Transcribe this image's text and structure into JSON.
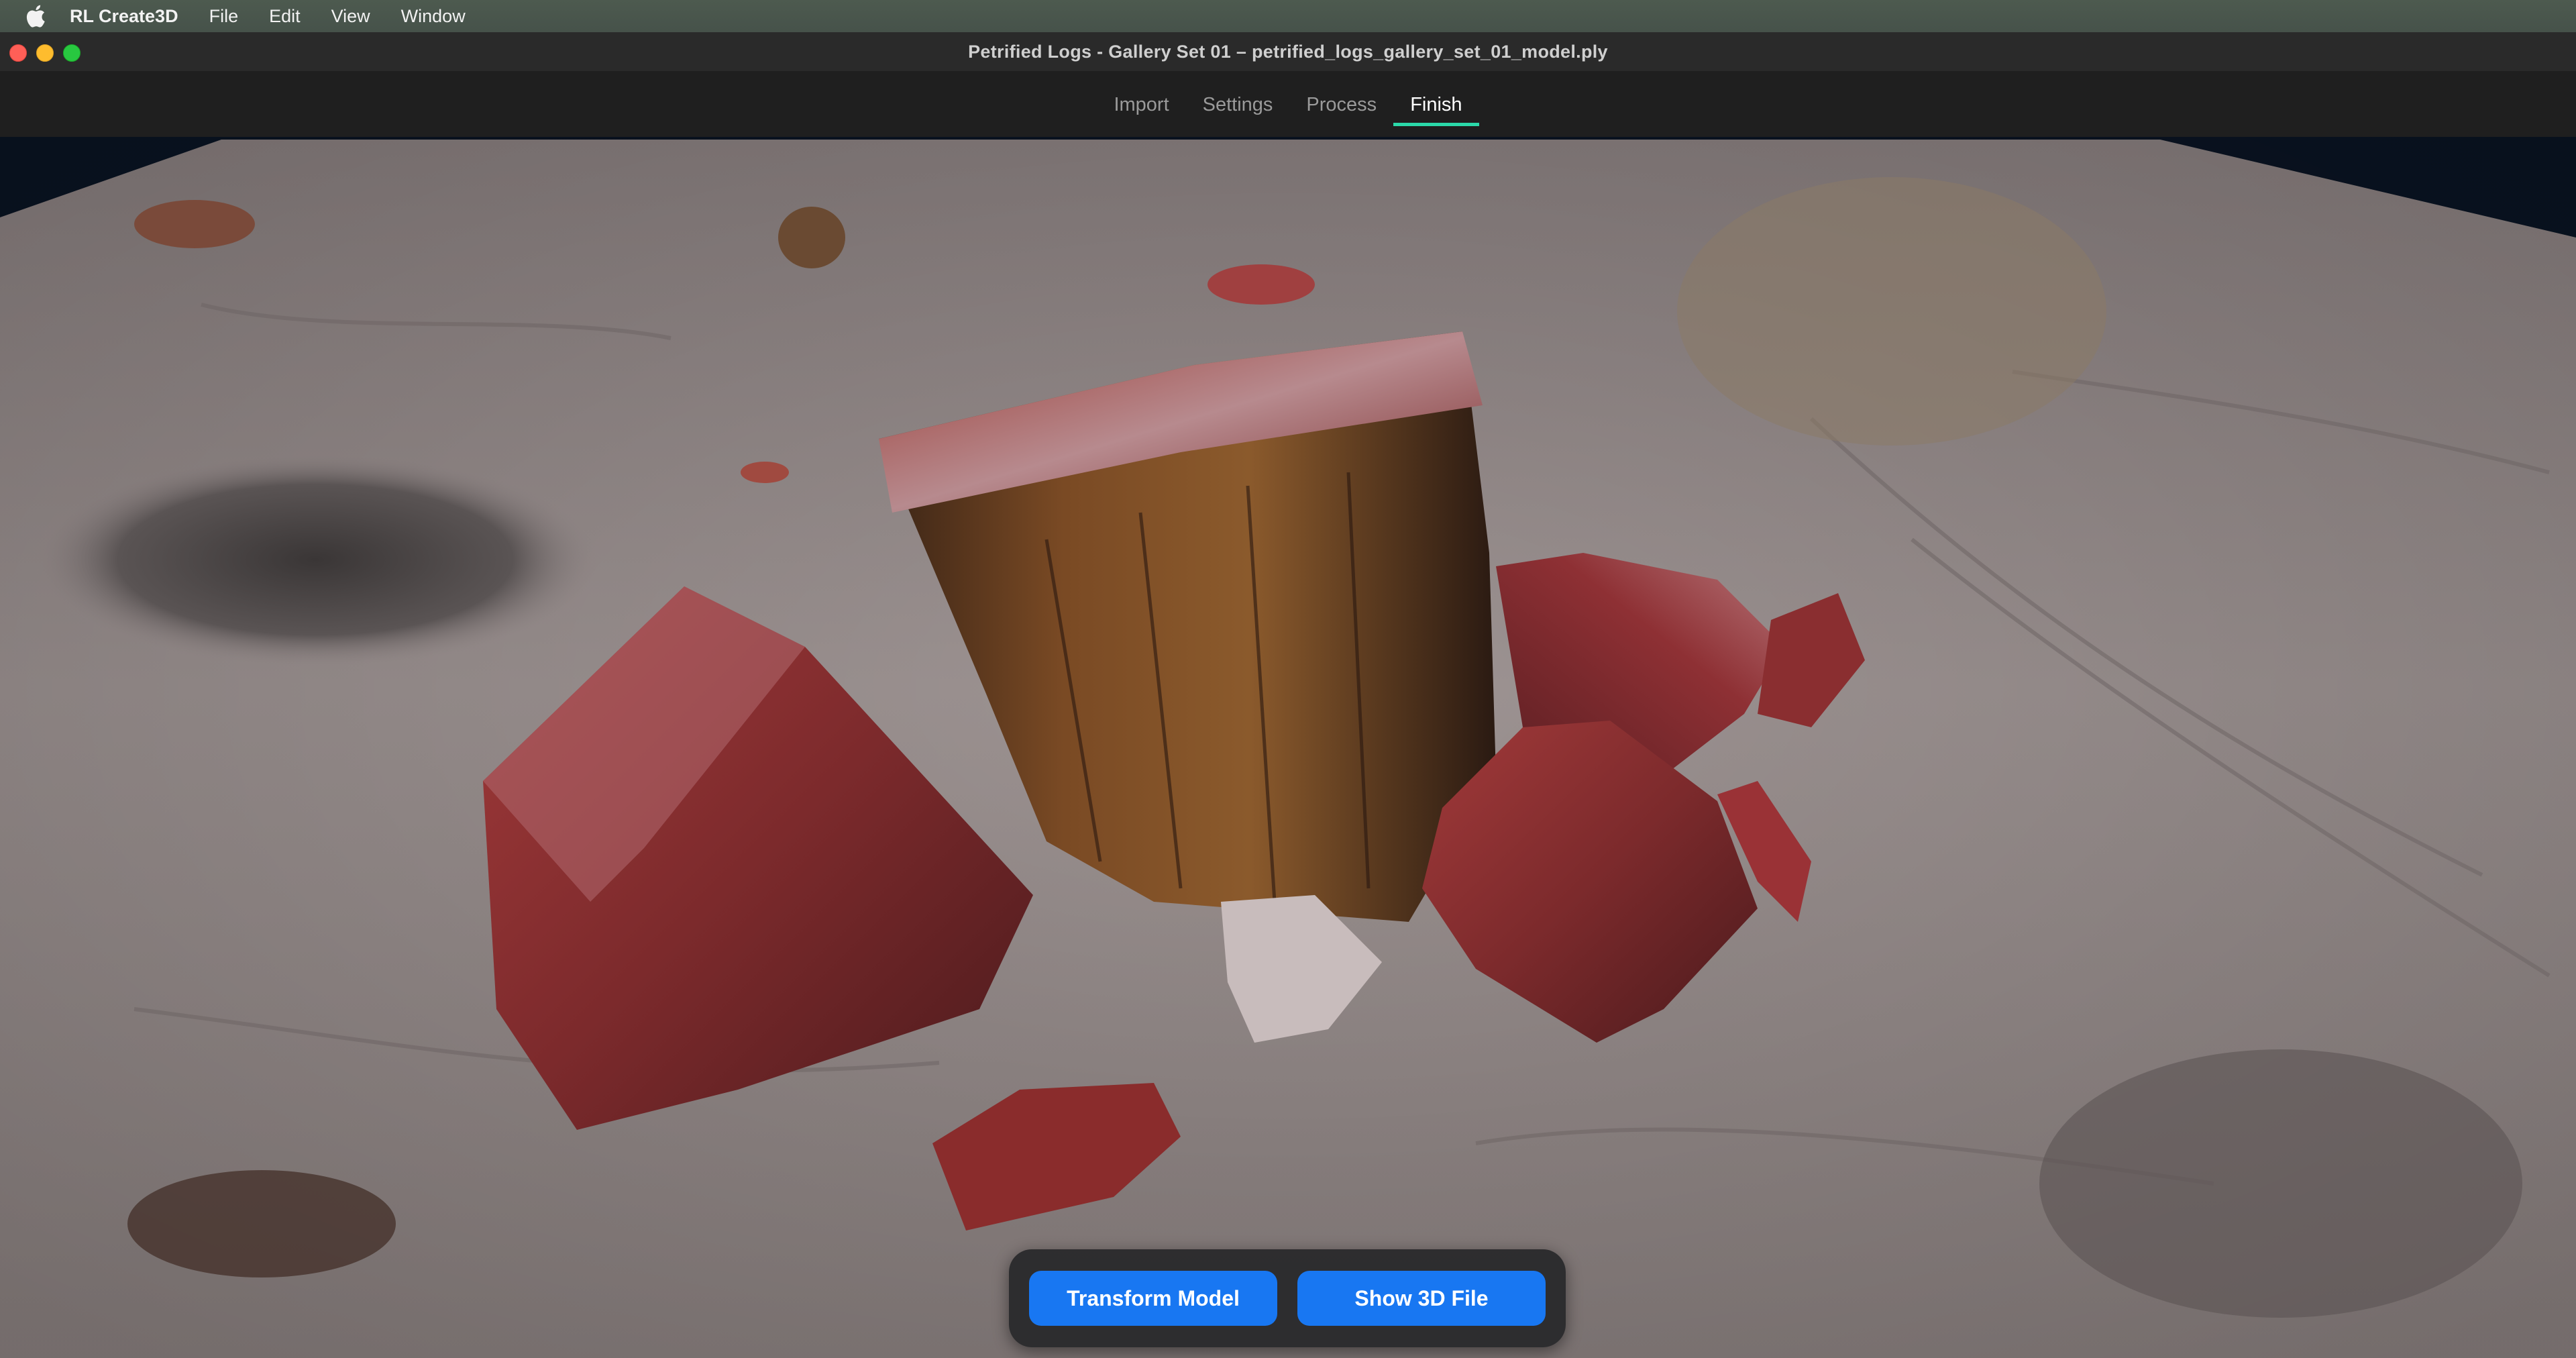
{
  "menubar": {
    "app_name": "RL Create3D",
    "items": [
      "File",
      "Edit",
      "View",
      "Window"
    ]
  },
  "window": {
    "title": "Petrified Logs - Gallery Set 01 – petrified_logs_gallery_set_01_model.ply"
  },
  "tabs": [
    {
      "label": "Import",
      "active": false
    },
    {
      "label": "Settings",
      "active": false
    },
    {
      "label": "Process",
      "active": false
    },
    {
      "label": "Finish",
      "active": true
    }
  ],
  "actions": {
    "transform_label": "Transform Model",
    "show_file_label": "Show 3D File"
  },
  "colors": {
    "accent_tab_underline": "#2bd9a9",
    "button_blue": "#1877f2",
    "viewport_background": "#0a1423"
  }
}
